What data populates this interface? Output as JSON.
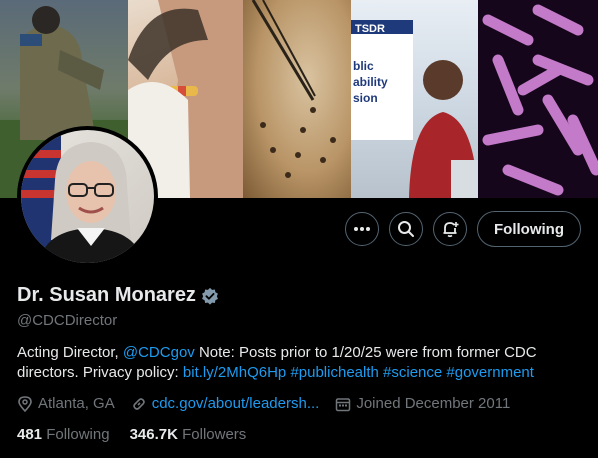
{
  "profile": {
    "name": "Dr. Susan Monarez",
    "handle": "@CDCDirector",
    "bio": {
      "p1": "Acting Director, ",
      "mention": "@CDCgov",
      "p2": " Note: Posts prior to 1/20/25 were from former CDC directors. Privacy policy: ",
      "link": "bit.ly/2MhQ6Hp",
      "tags": [
        "#publichealth",
        "#science",
        "#government"
      ]
    },
    "location": "Atlanta, GA",
    "website": "cdc.gov/about/leadersh...",
    "joined": "Joined December 2011",
    "following_count": "481",
    "following_label": "Following",
    "followers_count": "346.7K",
    "followers_label": "Followers"
  },
  "banner": {
    "sign_text": [
      "TSDR",
      "blic",
      "ability",
      "sion"
    ]
  },
  "actions": {
    "follow_label": "Following",
    "more_icon": "more-icon",
    "search_icon": "search-icon",
    "notify_icon": "bell-plus-icon"
  },
  "colors": {
    "accent": "#1d9bf0",
    "text": "#e7e9ea",
    "muted": "#71767b",
    "border": "#536471",
    "background": "#000000"
  }
}
